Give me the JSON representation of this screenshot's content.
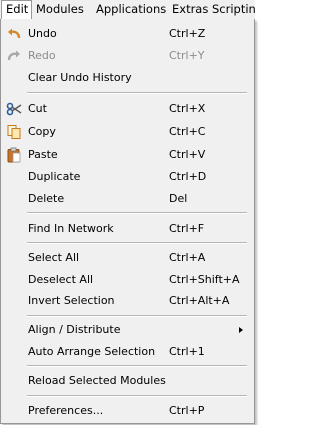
{
  "menubar": {
    "items": [
      {
        "label": "Edit"
      },
      {
        "label": "Modules"
      },
      {
        "label": "Applications"
      },
      {
        "label": "Extras"
      },
      {
        "label": "Scriptin"
      }
    ]
  },
  "edit_menu": {
    "undo": {
      "label": "Undo",
      "shortcut": "Ctrl+Z",
      "icon": "undo-icon"
    },
    "redo": {
      "label": "Redo",
      "shortcut": "Ctrl+Y",
      "icon": "redo-icon"
    },
    "clear_undo_history": {
      "label": "Clear Undo History"
    },
    "cut": {
      "label": "Cut",
      "shortcut": "Ctrl+X",
      "icon": "scissors-icon"
    },
    "copy": {
      "label": "Copy",
      "shortcut": "Ctrl+C",
      "icon": "copy-icon"
    },
    "paste": {
      "label": "Paste",
      "shortcut": "Ctrl+V",
      "icon": "paste-icon"
    },
    "duplicate": {
      "label": "Duplicate",
      "shortcut": "Ctrl+D"
    },
    "delete": {
      "label": "Delete",
      "shortcut": "Del"
    },
    "find_in_network": {
      "label": "Find In Network",
      "shortcut": "Ctrl+F"
    },
    "select_all": {
      "label": "Select All",
      "shortcut": "Ctrl+A"
    },
    "deselect_all": {
      "label": "Deselect All",
      "shortcut": "Ctrl+Shift+A"
    },
    "invert_selection": {
      "label": "Invert Selection",
      "shortcut": "Ctrl+Alt+A"
    },
    "align_distribute": {
      "label": "Align / Distribute"
    },
    "auto_arrange_selection": {
      "label": "Auto Arrange Selection",
      "shortcut": "Ctrl+1"
    },
    "reload_selected_modules": {
      "label": "Reload Selected Modules"
    },
    "preferences": {
      "label": "Preferences...",
      "shortcut": "Ctrl+P"
    }
  }
}
